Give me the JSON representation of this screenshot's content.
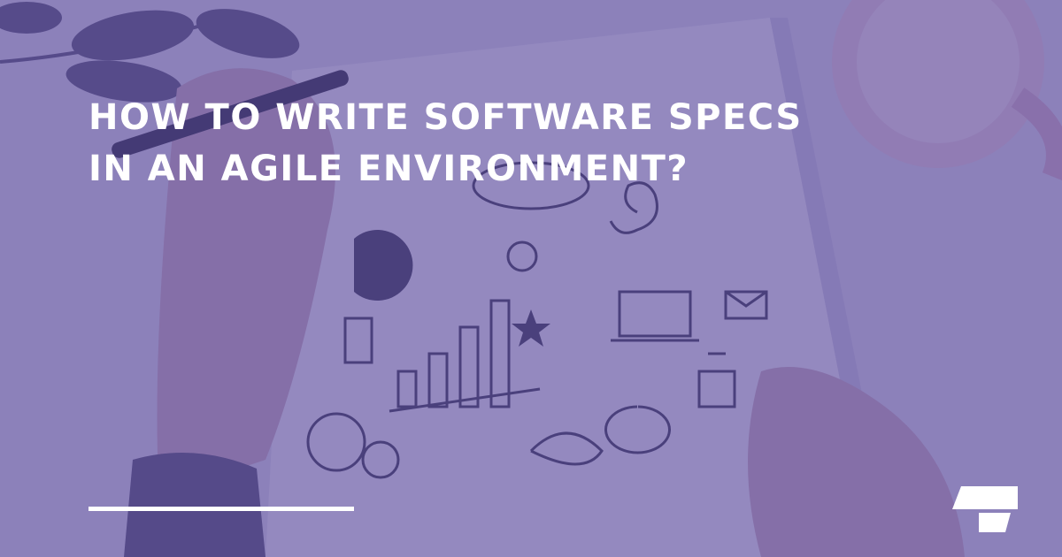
{
  "headline": {
    "line1": "HOW TO WRITE SOFTWARE SPECS",
    "line2": "IN AN AGILE ENVIRONMENT?"
  },
  "colors": {
    "overlay": "#5c4e9e",
    "paper": "#ece8f4",
    "ink": "#2e2a46",
    "text": "#ffffff",
    "accent_rule": "#ffffff"
  },
  "icons": [
    "notebook-sketch",
    "hand-with-pen",
    "coffee-cup",
    "leaves",
    "brand-logo"
  ]
}
